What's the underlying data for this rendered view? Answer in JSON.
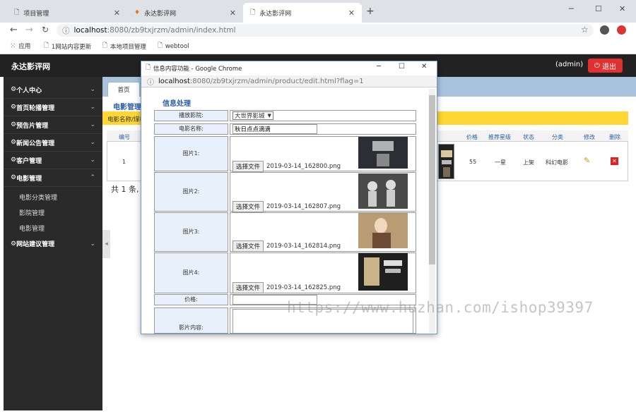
{
  "browser": {
    "tabs": [
      {
        "title": "项目管理",
        "icon": "page-icon"
      },
      {
        "title": "永达影评网",
        "icon": "color-page-icon"
      },
      {
        "title": "永达影评网",
        "icon": "page-icon"
      }
    ],
    "url_host": "localhost",
    "url_rest": ":8080/zb9txjrzm/admin/index.html",
    "bookmarks": [
      "应用",
      "1网站内容更新",
      "本地项目管理",
      "webtool"
    ]
  },
  "app": {
    "title": "永达影评网",
    "user": "(admin)",
    "logout": "退出",
    "sidebar": [
      {
        "label": "个人中心"
      },
      {
        "label": "首页轮播管理"
      },
      {
        "label": "预告片管理"
      },
      {
        "label": "新闻公告管理"
      },
      {
        "label": "客户管理"
      },
      {
        "label": "电影管理"
      }
    ],
    "submenu": [
      "电影分类管理",
      "影院管理",
      "电影管理"
    ],
    "sidebar_last": "网站建议管理",
    "tab_home": "首页",
    "section_title": "电影管理",
    "notice": "电影名称/煤检",
    "table": {
      "headers_left": [
        "编号"
      ],
      "headers_right": [
        "价格",
        "推荐星级",
        "状态",
        "分类",
        "修改",
        "删除"
      ],
      "row": {
        "id": "1",
        "price": "55",
        "stars": "一星",
        "status": "上架",
        "category": "科幻电影"
      }
    },
    "footer": "共 1 条,"
  },
  "popup": {
    "window_title": "信息内容功能 - Google Chrome",
    "url_host": "localhost",
    "url_rest": ":8080/zb9txjrzm/admin/product/edit.html?flag=1",
    "heading": "信息处理",
    "fields": {
      "cinema_label": "播放影院:",
      "cinema_value": "大世界影城",
      "name_label": "电影名称:",
      "name_value": "秋日点点滴滴",
      "images": [
        {
          "label": "图片1:",
          "file": "2019-03-14_162800.png"
        },
        {
          "label": "图片2:",
          "file": "2019-03-14_162807.png"
        },
        {
          "label": "图片3:",
          "file": "2019-03-14_162814.png"
        },
        {
          "label": "图片4:",
          "file": "2019-03-14_162825.png"
        }
      ],
      "choose_file": "选择文件",
      "price_label": "价格:",
      "content_label": "影片内容:"
    }
  },
  "watermark": "https://www.huzhan.com/ishop39397",
  "colors": {
    "accent": "#2a5ea8",
    "logout": "#e03030",
    "notice_bg": "#ffd633",
    "sidebar": "#2a2a2a"
  }
}
